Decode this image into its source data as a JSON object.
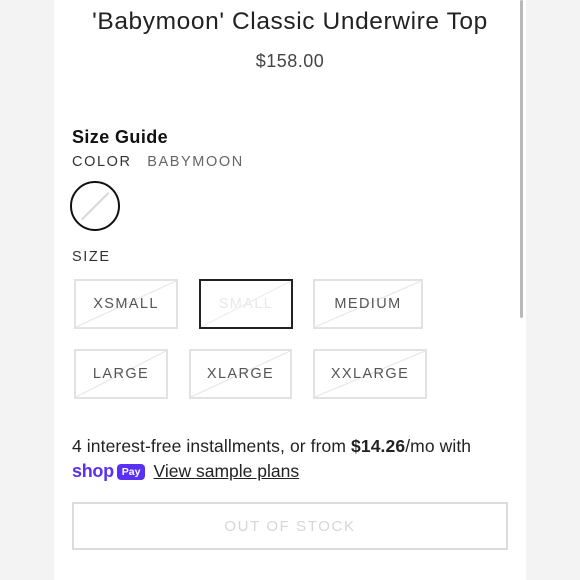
{
  "product": {
    "title": "'Babymoon' Classic Underwire Top",
    "price": "$158.00"
  },
  "size_guide_label": "Size Guide",
  "color": {
    "label": "COLOR",
    "value": "BABYMOON",
    "swatch_color": "#ffffff"
  },
  "size": {
    "label": "SIZE",
    "selected": "SMALL",
    "options": [
      {
        "label": "XSMALL",
        "available": false
      },
      {
        "label": "SMALL",
        "available": false
      },
      {
        "label": "MEDIUM",
        "available": false
      },
      {
        "label": "LARGE",
        "available": false
      },
      {
        "label": "XLARGE",
        "available": false
      },
      {
        "label": "XXLARGE",
        "available": false
      }
    ]
  },
  "installments": {
    "prefix": "4 interest-free installments, or from ",
    "amount": "$14.26",
    "suffix": "/mo with"
  },
  "shop_pay": {
    "shop": "shop",
    "pay": "Pay",
    "link_label": "View sample plans",
    "brand_color": "#5a31f4"
  },
  "cta": {
    "label": "OUT OF STOCK",
    "disabled": true
  }
}
